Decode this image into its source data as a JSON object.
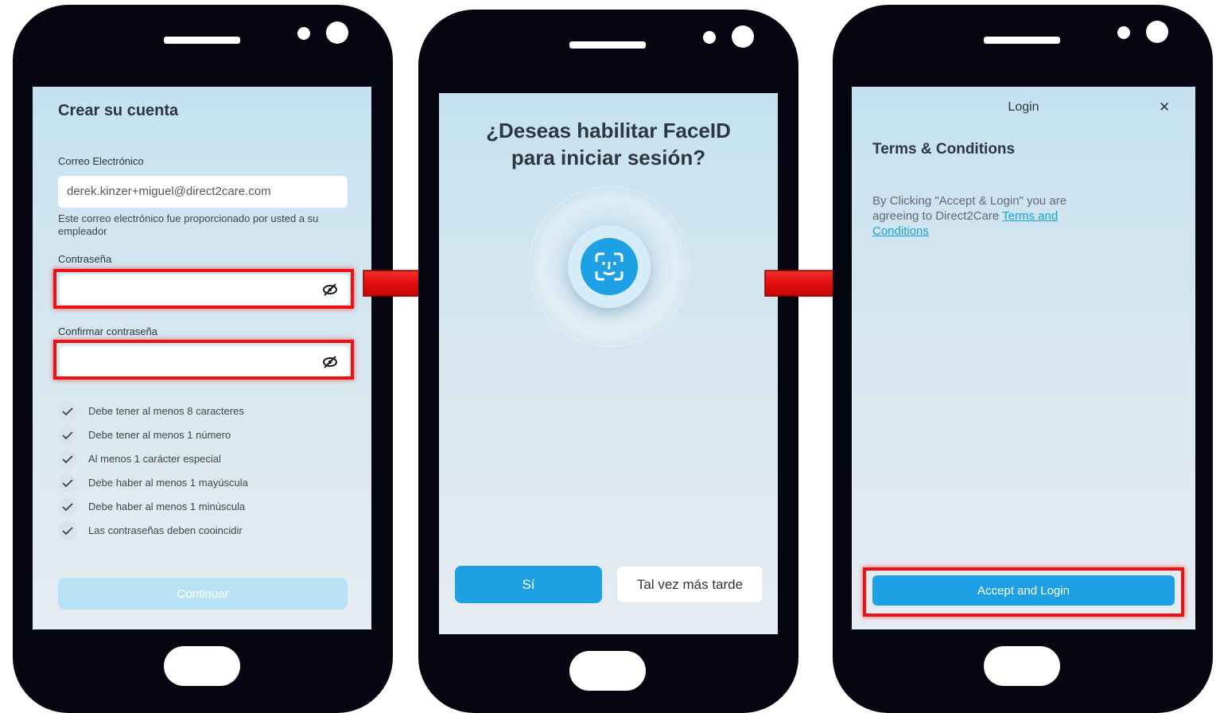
{
  "screen1": {
    "title": "Crear su cuenta",
    "email_label": "Correo Electrónico",
    "email_value": "derek.kinzer+miguel@direct2care.com",
    "email_hint": "Este correo electrónico fue proporcionado por usted a su empleador",
    "password_label": "Contraseña",
    "confirm_label": "Confirmar contraseña",
    "requirements": [
      "Debe tener al menos 8 caracteres",
      "Debe tener al menos 1 número",
      "Al menos 1 carácter especial",
      "Debe haber al menos 1 mayúscula",
      "Debe haber al menos 1 minúscula",
      "Las contraseñas deben cooincidir"
    ],
    "continue_label": "Continuar"
  },
  "screen2": {
    "title_line1": "¿Deseas habilitar FaceID",
    "title_line2": "para iniciar sesión?",
    "yes_label": "Sí",
    "later_label": "Tal vez más tarde"
  },
  "screen3": {
    "header": "Login",
    "close_symbol": "✕",
    "title": "Terms & Conditions",
    "body_line1": "By Clicking \"Accept & Login\" you are",
    "body_line2": "agreeing to Direct2Care",
    "link_part1": "Terms and",
    "link_part2": "Conditions",
    "accept_label": "Accept and Login"
  },
  "icons": {
    "eye_off": "eye-off-icon",
    "check": "check-icon",
    "face_id": "face-id-icon",
    "arrow": "arrow-right-icon",
    "close": "close-icon"
  },
  "colors": {
    "phone_body": "#060512",
    "accent_blue": "#1ea1e4",
    "highlight_red": "#ee1111",
    "link_blue": "#1aa0d8",
    "disabled_button": "#b9e3f5"
  }
}
